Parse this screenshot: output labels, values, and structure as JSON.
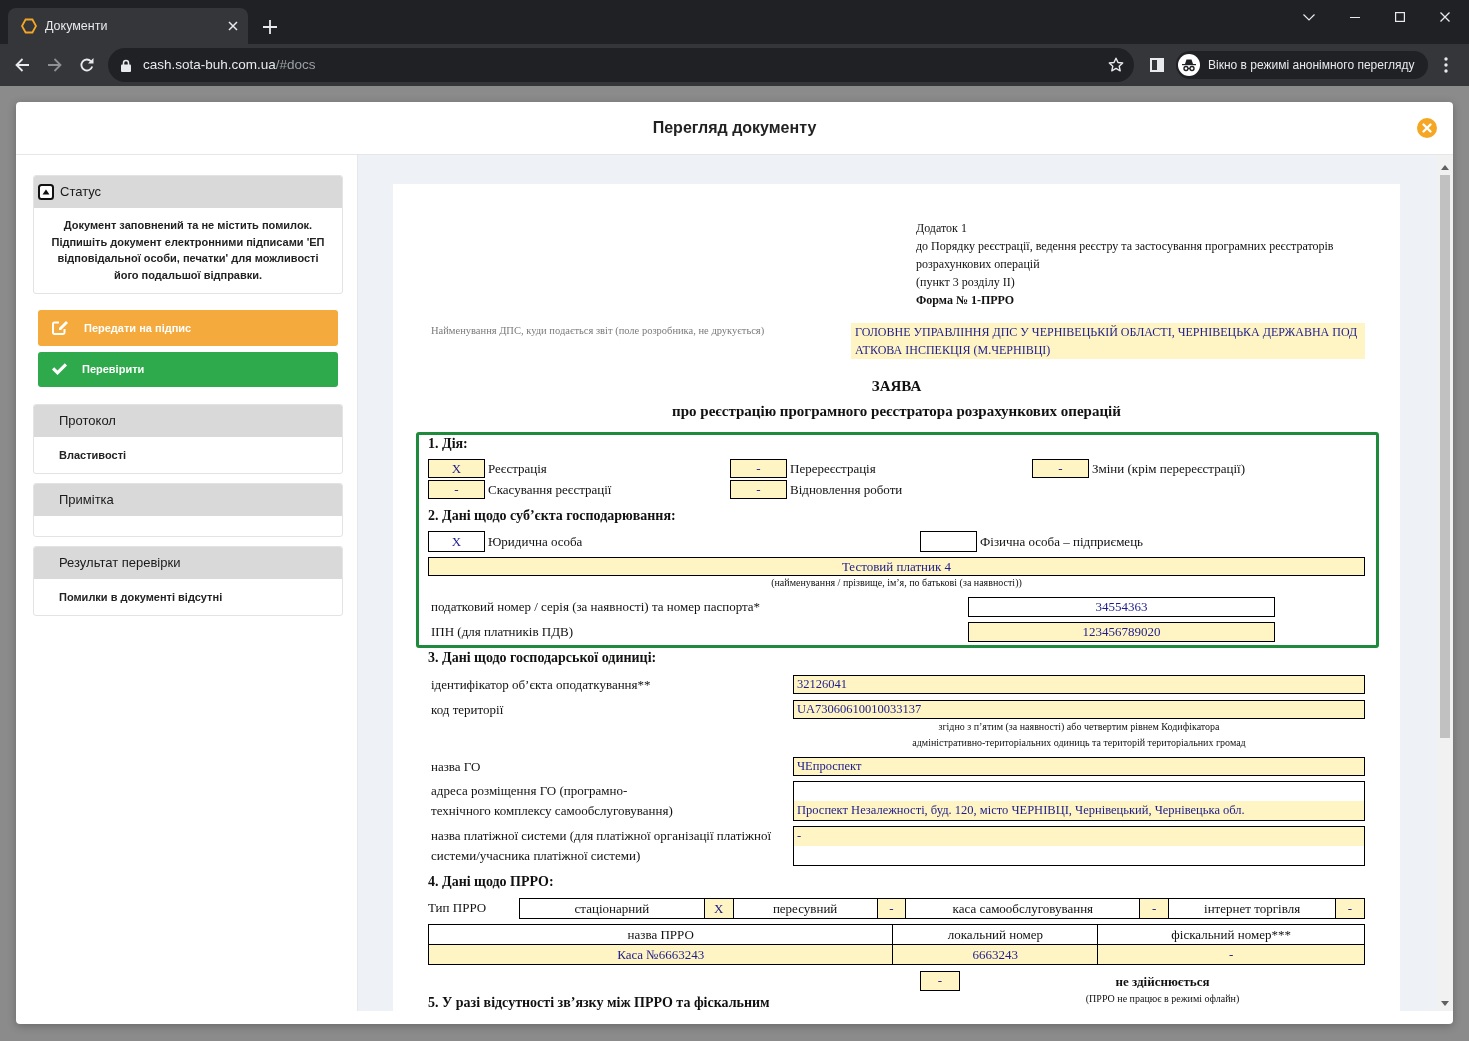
{
  "browser": {
    "tab": {
      "title": "Документи"
    },
    "url": {
      "host": "cash.sota-buh.com.ua",
      "path": "/#docs"
    },
    "profile_chip": "Вікно в режимі анонімного перегляду"
  },
  "modal": {
    "title": "Перегляд документу",
    "sidebar": {
      "status": {
        "title": "Статус",
        "message": "Документ заповнений та не містить помилок. Підпишіть документ електронними підписами 'ЕП відповідальної особи, печатки' для можливості його подальшої відправки."
      },
      "actions": [
        {
          "kind": "sign",
          "label": "Передати на підпис"
        },
        {
          "kind": "check",
          "label": "Перевірити"
        }
      ],
      "panels": [
        {
          "kind": "link",
          "title": "Протокол",
          "body": "Властивості"
        },
        {
          "kind": "empty",
          "title": "Примітка"
        },
        {
          "kind": "text",
          "title": "Результат перевірки",
          "body": "Помилки в документі відсутні"
        }
      ]
    },
    "document": {
      "appendix": {
        "lines": [
          "Додаток 1",
          "до Порядку реєстрації, ведення реєстру та застосування програмних реєстраторів розрахункових операцій",
          "(пункт 3 розділу ІІ)"
        ],
        "form": "Форма № 1-ПРРО"
      },
      "authority": {
        "label": "Найменування ДПС, куди подається звіт (поле розробника, не друкується)",
        "value": "ГОЛОВНЕ УПРАВЛІННЯ ДПС У ЧЕРНІВЕЦЬКІЙ ОБЛАСТІ, ЧЕРНІВЕЦЬКА ДЕРЖАВНА ПОДАТКОВА ІНСПЕКЦІЯ (М.ЧЕРНІВЦІ)"
      },
      "title": "ЗАЯВА",
      "subtitle": "про реєстрацію програмного реєстратора розрахункових операцій",
      "blocks": [
        {
          "outlined": true,
          "sections": [
            {
              "kind": "actions",
              "heading": "1. Дія:",
              "options": [
                {
                  "mark": "X",
                  "label": "Реєстрація",
                  "highlighted": true
                },
                {
                  "mark": "-",
                  "label": "Перереєстрація",
                  "highlighted": true
                },
                {
                  "mark": "-",
                  "label": "Зміни (крім перереєстрації)",
                  "highlighted": true
                },
                {
                  "mark": "-",
                  "label": "Скасування реєстрації",
                  "highlighted": true
                },
                {
                  "mark": "-",
                  "label": "Відновлення роботи",
                  "highlighted": true
                }
              ]
            },
            {
              "kind": "entity",
              "heading": "2. Дані щодо суб’єкта господарювання:",
              "options": [
                {
                  "mark": "X",
                  "label": "Юридична особа",
                  "highlighted": false
                },
                {
                  "label": "Фізична особа – підприємець",
                  "highlighted": false
                }
              ],
              "name": {
                "value": "Тестовий платник 4",
                "caption": "(найменування / прізвище, ім’я, по батькові (за наявності))"
              },
              "fields": [
                {
                  "label": "податковий номер / серія (за наявності) та номер паспорта*",
                  "value": "34554363",
                  "highlighted": false
                },
                {
                  "label": "ІПН (для платників ПДВ)",
                  "value": "123456789020",
                  "highlighted": true
                }
              ]
            }
          ]
        },
        {
          "outlined": false,
          "sections": [
            {
              "kind": "unit",
              "heading": "3. Дані щодо господарської одиниці:",
              "fields": [
                {
                  "kind": "line",
                  "label": "ідентифікатор об’єкта оподаткування**",
                  "value": "32126041"
                },
                {
                  "kind": "line",
                  "label": "код території",
                  "value": "UA73060610010033137",
                  "note": "згідно з п’ятим (за наявності) або четвертим рівнем Кодифікатора\nадміністративно-територіальних одиниць та територій територіальних громад"
                },
                {
                  "kind": "line",
                  "label": "назва ГО",
                  "value": "ЧЕпроспект"
                },
                {
                  "kind": "block_bottom",
                  "label": "адреса розміщення ГО (програмно-\nтехнічного комплексу самообслуговування)",
                  "value": "Проспект Незалежності, буд. 120, місто ЧЕРНІВЦІ, Чернівецький, Чернівецька обл."
                },
                {
                  "kind": "block_top",
                  "label": "назва платіжної системи (для платіжної організації платіжної системи/учасника платіжної системи)",
                  "value": "-"
                }
              ]
            },
            {
              "kind": "prro",
              "heading": "4. Дані щодо ПРРО:",
              "type_label": "Тип ПРРО",
              "types": [
                {
                  "label": "стаціонарний",
                  "mark": "X"
                },
                {
                  "label": "пересувний",
                  "mark": "-"
                },
                {
                  "label": "каса самообслуговування",
                  "mark": "-"
                },
                {
                  "label": "інтернет торгівля",
                  "mark": "-"
                }
              ],
              "table": {
                "columns": [
                  "назва ПРРО",
                  "локальний номер",
                  "фіскальний номер***"
                ],
                "rows": [
                  [
                    "Каса №6663243",
                    "6663243",
                    "-"
                  ]
                ]
              }
            },
            {
              "kind": "offline",
              "heading": "5. У разі відсутності зв’язку між ПРРО та фіскальним",
              "options": [
                {
                  "mark": "-",
                  "label": "не здійснюється",
                  "note": "(ПРРО не працює в режимі офлайн)"
                }
              ]
            }
          ]
        }
      ]
    }
  }
}
